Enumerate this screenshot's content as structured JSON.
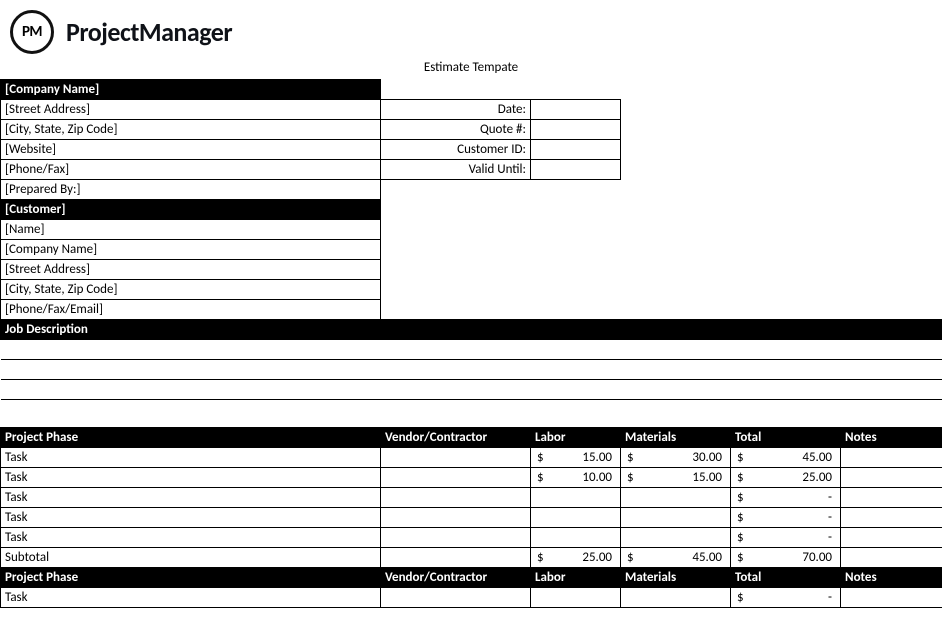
{
  "logo": {
    "badge": "PM",
    "text": "ProjectManager"
  },
  "title": "Estimate Tempate",
  "company": {
    "header": "[Company Name]",
    "street": "[Street Address]",
    "csz": "[City, State, Zip Code]",
    "website": "[Website]",
    "phone": "[Phone/Fax]",
    "prepared": "[Prepared By:]"
  },
  "meta": {
    "date_label": "Date:",
    "quote_label": "Quote #:",
    "cust_label": "Customer ID:",
    "valid_label": "Valid Until:",
    "date_val": "",
    "quote_val": "",
    "cust_val": "",
    "valid_val": ""
  },
  "customer": {
    "header": "[Customer]",
    "name": "[Name]",
    "company": "[Company Name]",
    "street": "[Street Address]",
    "csz": "[City, State, Zip Code]",
    "phone": "[Phone/Fax/Email]"
  },
  "job_desc_header": "Job Description",
  "cols": {
    "phase": "Project Phase",
    "vendor": "Vendor/Contractor",
    "labor": "Labor",
    "materials": "Materials",
    "total": "Total",
    "notes": "Notes"
  },
  "currency": "$",
  "dash": "-",
  "phase1": {
    "rows": [
      {
        "task": "Task",
        "vendor": "",
        "labor": "15.00",
        "materials": "30.00",
        "total": "45.00",
        "notes": ""
      },
      {
        "task": "Task",
        "vendor": "",
        "labor": "10.00",
        "materials": "15.00",
        "total": "25.00",
        "notes": ""
      },
      {
        "task": "Task",
        "vendor": "",
        "labor": "",
        "materials": "",
        "total": "-",
        "notes": ""
      },
      {
        "task": "Task",
        "vendor": "",
        "labor": "",
        "materials": "",
        "total": "-",
        "notes": ""
      },
      {
        "task": "Task",
        "vendor": "",
        "labor": "",
        "materials": "",
        "total": "-",
        "notes": ""
      }
    ],
    "subtotal": {
      "label": "Subtotal",
      "labor": "25.00",
      "materials": "45.00",
      "total": "70.00"
    }
  },
  "phase2": {
    "rows": [
      {
        "task": "Task",
        "vendor": "",
        "labor": "",
        "materials": "",
        "total": "-",
        "notes": ""
      }
    ]
  }
}
